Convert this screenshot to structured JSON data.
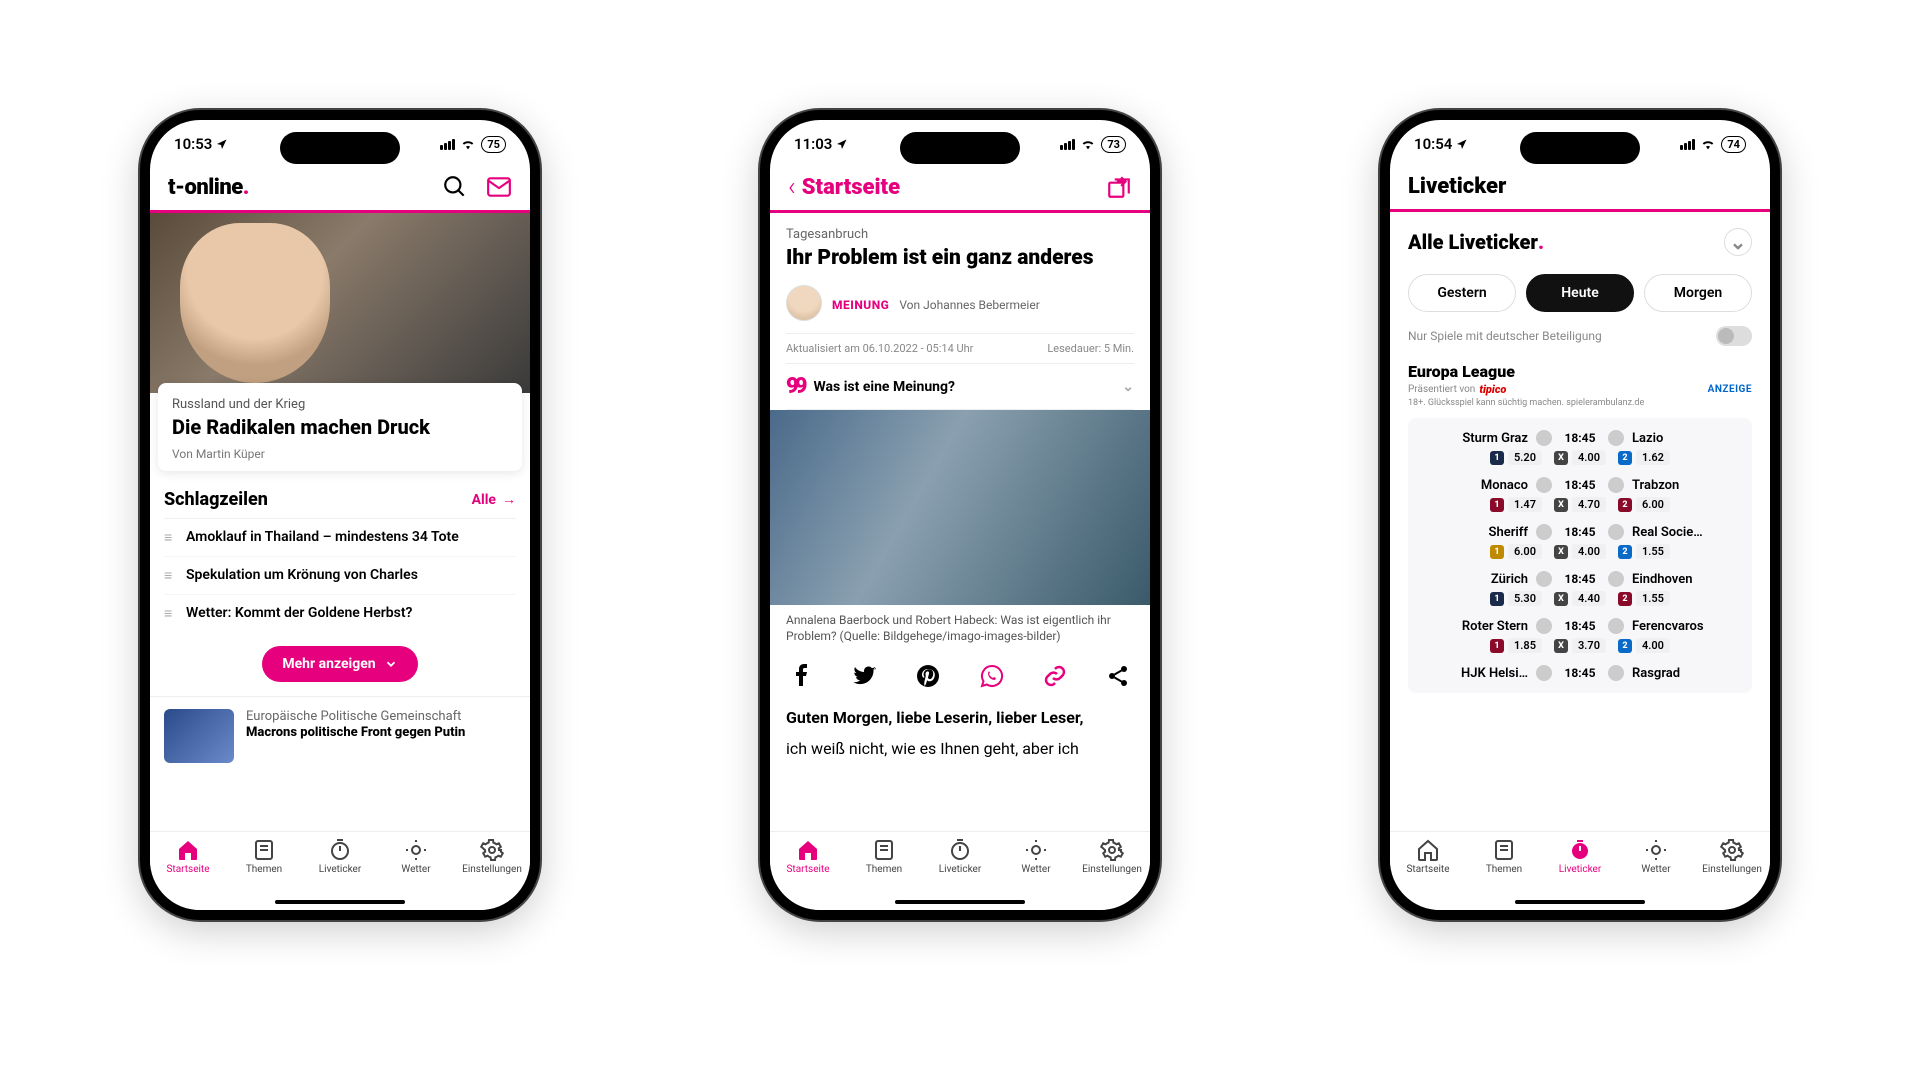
{
  "phones": [
    {
      "time": "10:53",
      "battery": "75"
    },
    {
      "time": "11:03",
      "battery": "73"
    },
    {
      "time": "10:54",
      "battery": "74"
    }
  ],
  "brand": "t-online",
  "p1": {
    "hero": {
      "kicker": "Russland und der Krieg",
      "title": "Die Radikalen machen Druck",
      "by": "Von Martin Küper"
    },
    "headlines_title": "Schlagzeilen",
    "all": "Alle",
    "headlines": [
      "Amoklauf in Thailand – mindestens 34 Tote",
      "Spekulation um Krönung von Charles",
      "Wetter: Kommt der Goldene Herbst?"
    ],
    "more": "Mehr anzeigen",
    "item": {
      "kicker": "Europäische Politische Gemeinschaft",
      "title": "Macrons politische Front gegen Putin"
    }
  },
  "p2": {
    "back": "Startseite",
    "kicker": "Tagesanbruch",
    "title": "Ihr Problem ist ein ganz anderes",
    "tag": "MEINUNG",
    "author": "Von Johannes Bebermeier",
    "updated": "Aktualisiert am 06.10.2022 - 05:14 Uhr",
    "read": "Lesedauer: 5 Min.",
    "expander": "Was ist eine Meinung?",
    "caption": "Annalena Baerbock und Robert Habeck: Was ist eigentlich ihr Problem? (Quelle: Bildgehege/imago-images-bilder)",
    "para1": "Guten Morgen, liebe Leserin, lieber Leser,",
    "para2": "ich weiß nicht, wie es Ihnen geht, aber ich"
  },
  "p3": {
    "title": "Liveticker",
    "all": "Alle Liveticker",
    "tabs": {
      "y": "Gestern",
      "t": "Heute",
      "m": "Morgen"
    },
    "filter": "Nur Spiele mit deutscher Beteiligung",
    "league": "Europa League",
    "pres": "Präsentiert von",
    "sponsor": "tipico",
    "ad": "ANZEIGE",
    "disc": "18+. Glücksspiel kann süchtig machen. spielerambulanz.de",
    "matches": [
      {
        "h": "Sturm Graz",
        "a": "Lazio",
        "t": "18:45",
        "o": [
          "5.20",
          "4.00",
          "1.62"
        ],
        "c": [
          "t1",
          "tX",
          "t2"
        ]
      },
      {
        "h": "Monaco",
        "a": "Trabzon",
        "t": "18:45",
        "o": [
          "1.47",
          "4.70",
          "6.00"
        ],
        "c": [
          "tr2",
          "tX",
          "tr2"
        ]
      },
      {
        "h": "Sheriff",
        "a": "Real Socie…",
        "t": "18:45",
        "o": [
          "6.00",
          "4.00",
          "1.55"
        ],
        "c": [
          "tg",
          "tX",
          "t2"
        ]
      },
      {
        "h": "Zürich",
        "a": "Eindhoven",
        "t": "18:45",
        "o": [
          "5.30",
          "4.40",
          "1.55"
        ],
        "c": [
          "t1",
          "tX",
          "tr2"
        ]
      },
      {
        "h": "Roter Stern",
        "a": "Ferencvaros",
        "t": "18:45",
        "o": [
          "1.85",
          "3.70",
          "4.00"
        ],
        "c": [
          "tr2",
          "tX",
          "t2"
        ]
      },
      {
        "h": "HJK Helsi…",
        "a": "Rasgrad",
        "t": "18:45",
        "o": [
          "",
          "",
          ""
        ],
        "c": [
          "t1",
          "tX",
          "t2"
        ]
      }
    ]
  },
  "tabs": [
    {
      "l": "Startseite"
    },
    {
      "l": "Themen"
    },
    {
      "l": "Liveticker"
    },
    {
      "l": "Wetter"
    },
    {
      "l": "Einstellungen"
    }
  ]
}
